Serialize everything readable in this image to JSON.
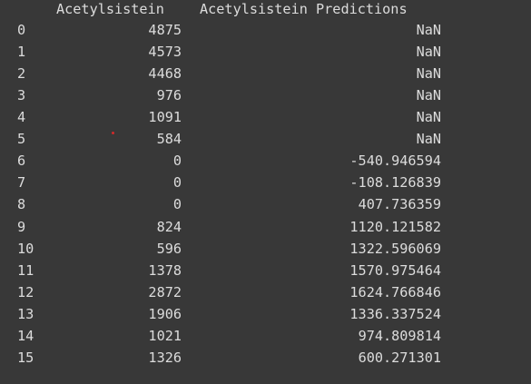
{
  "table": {
    "columns": [
      "",
      "Acetylsistein",
      "Acetylsistein Predictions"
    ],
    "rows": [
      {
        "index": "0",
        "acetylsistein": "4875",
        "prediction": "NaN"
      },
      {
        "index": "1",
        "acetylsistein": "4573",
        "prediction": "NaN"
      },
      {
        "index": "2",
        "acetylsistein": "4468",
        "prediction": "NaN"
      },
      {
        "index": "3",
        "acetylsistein": "976",
        "prediction": "NaN"
      },
      {
        "index": "4",
        "acetylsistein": "1091",
        "prediction": "NaN"
      },
      {
        "index": "5",
        "acetylsistein": "584",
        "prediction": "NaN"
      },
      {
        "index": "6",
        "acetylsistein": "0",
        "prediction": "-540.946594"
      },
      {
        "index": "7",
        "acetylsistein": "0",
        "prediction": "-108.126839"
      },
      {
        "index": "8",
        "acetylsistein": "0",
        "prediction": "407.736359"
      },
      {
        "index": "9",
        "acetylsistein": "824",
        "prediction": "1120.121582"
      },
      {
        "index": "10",
        "acetylsistein": "596",
        "prediction": "1322.596069"
      },
      {
        "index": "11",
        "acetylsistein": "1378",
        "prediction": "1570.975464"
      },
      {
        "index": "12",
        "acetylsistein": "2872",
        "prediction": "1624.766846"
      },
      {
        "index": "13",
        "acetylsistein": "1906",
        "prediction": "1336.337524"
      },
      {
        "index": "14",
        "acetylsistein": "1021",
        "prediction": "974.809814"
      },
      {
        "index": "15",
        "acetylsistein": "1326",
        "prediction": "600.271301"
      }
    ]
  },
  "colors": {
    "background": "#383838",
    "text": "#dcdcdc",
    "marker": "#d22a2a"
  }
}
